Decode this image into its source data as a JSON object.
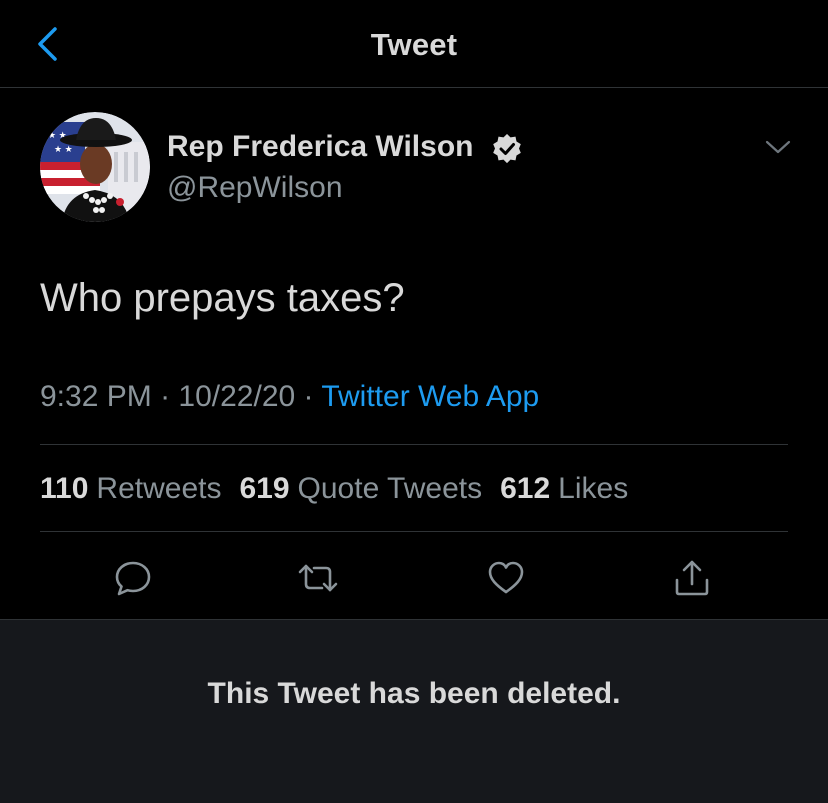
{
  "header": {
    "title": "Tweet",
    "back_icon": "chevron-left-icon"
  },
  "author": {
    "name": "Rep Frederica Wilson",
    "handle": "@RepWilson",
    "verified": true,
    "avatar_icon": "profile-photo"
  },
  "tweet": {
    "text": "Who prepays taxes?",
    "time": "9:32 PM",
    "separator": "·",
    "date": "10/22/20",
    "source": "Twitter Web App"
  },
  "stats": {
    "retweets": {
      "count": "110",
      "label": "Retweets"
    },
    "quotes": {
      "count": "619",
      "label": "Quote Tweets"
    },
    "likes": {
      "count": "612",
      "label": "Likes"
    }
  },
  "actions": [
    "reply-icon",
    "retweet-icon",
    "like-icon",
    "share-icon"
  ],
  "notice": {
    "text": "This Tweet has been deleted."
  },
  "colors": {
    "background": "#000000",
    "accent": "#1d9bf0",
    "text_primary": "#d9d9d9",
    "text_secondary": "#8b949a",
    "divider": "#2f3336",
    "panel": "#16181c"
  }
}
